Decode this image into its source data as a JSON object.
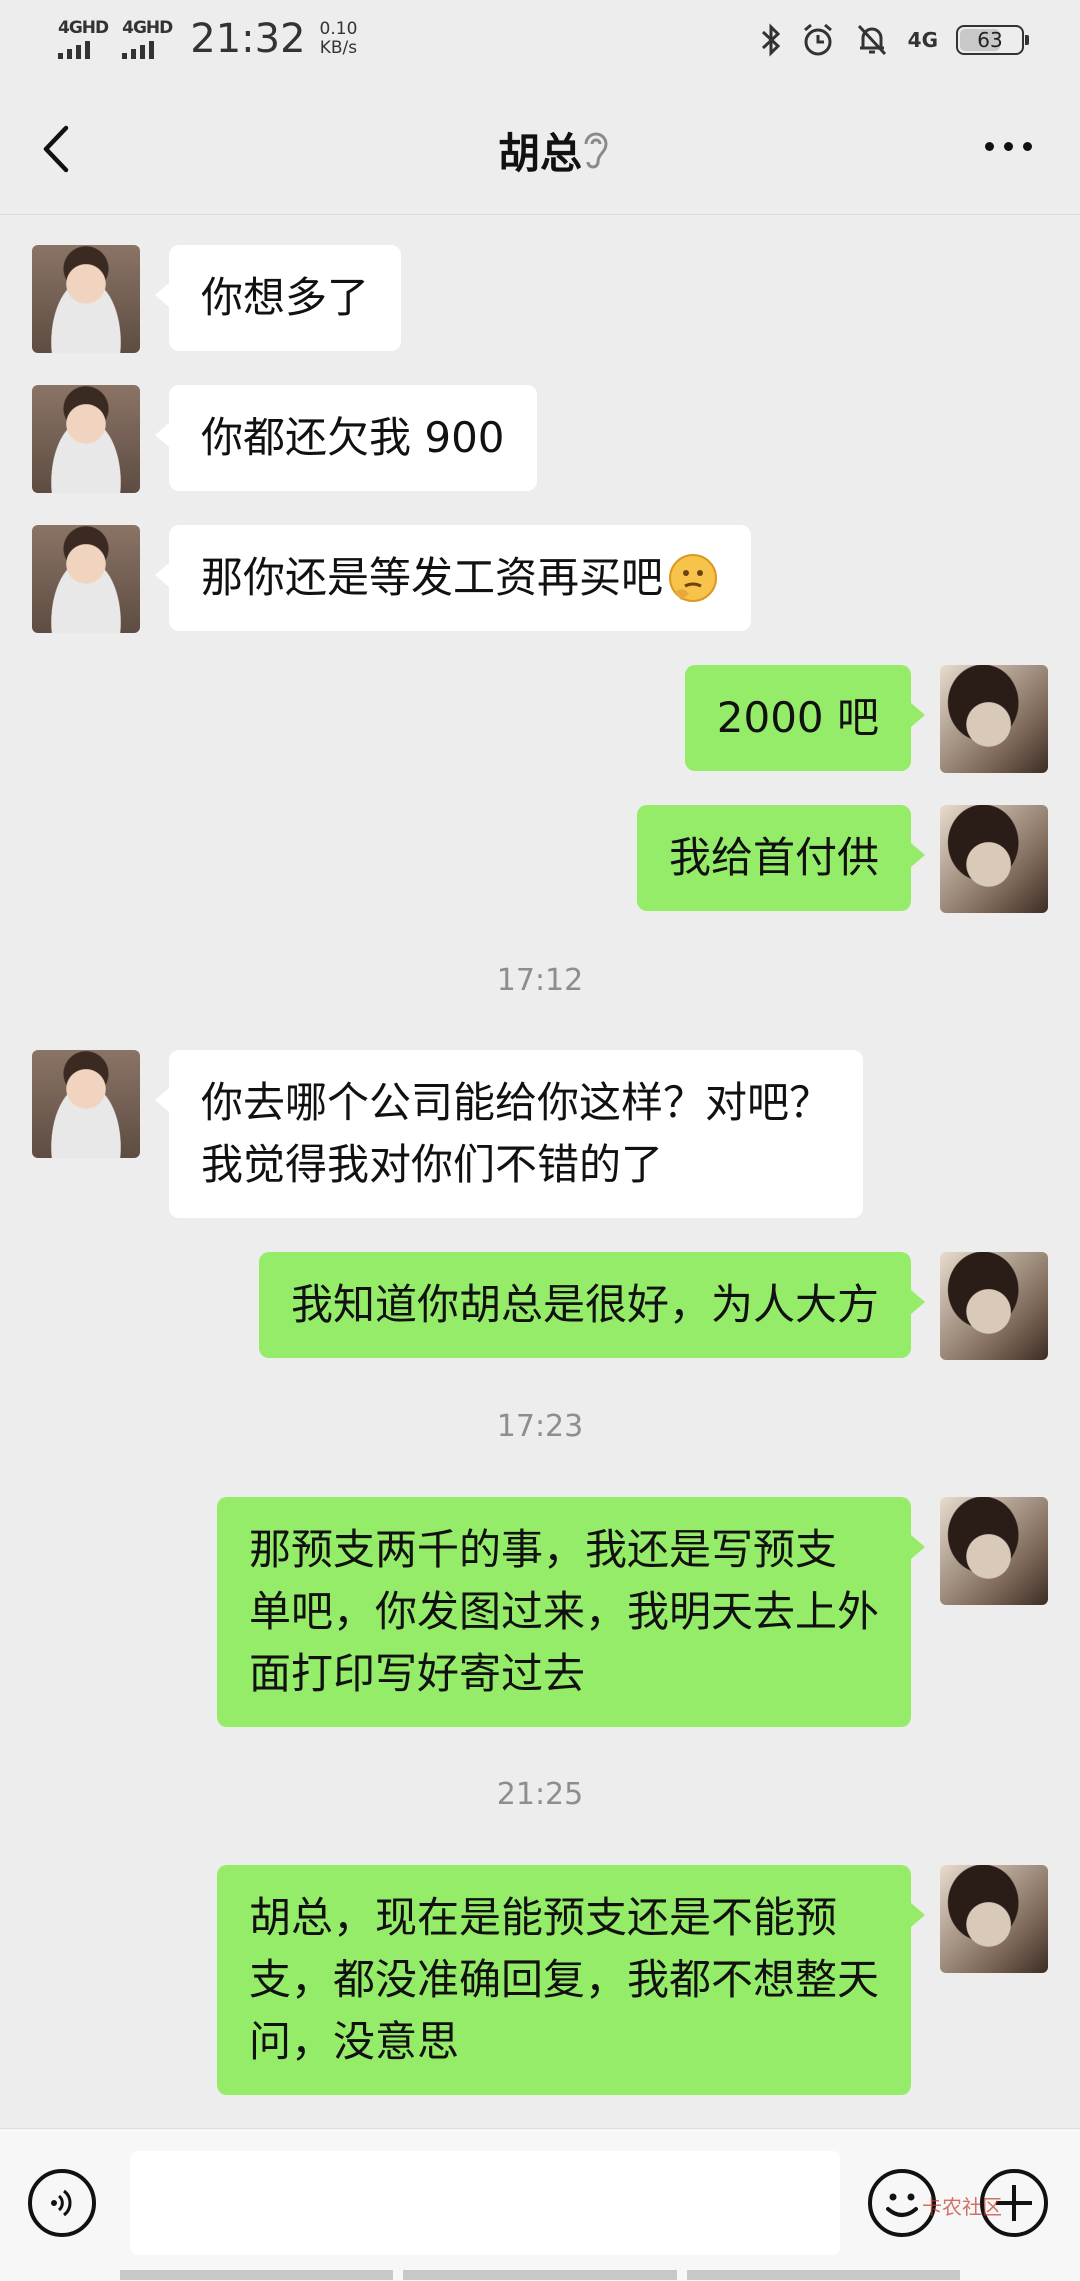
{
  "status_bar": {
    "signal_1": "4GHD",
    "signal_2": "4GHD",
    "time": "21:32",
    "speed_value": "0.10",
    "speed_unit": "KB/s",
    "network": "4G",
    "battery": "63",
    "icons": [
      "bluetooth-icon",
      "alarm-icon",
      "mute-icon"
    ]
  },
  "header": {
    "title": "胡总",
    "icons": [
      "back-icon",
      "earpiece-icon",
      "more-icon"
    ]
  },
  "messages": [
    {
      "side": "in",
      "text": "你想多了"
    },
    {
      "side": "in",
      "text": "你都还欠我 900"
    },
    {
      "side": "in",
      "text": "那你还是等发工资再买吧",
      "emoji": "thinking-face"
    },
    {
      "side": "out",
      "text": "2000 吧"
    },
    {
      "side": "out",
      "text": "我给首付供"
    },
    {
      "time": "17:12"
    },
    {
      "side": "in",
      "text": "你去哪个公司能给你这样？对吧？\n我觉得我对你们不错的了"
    },
    {
      "side": "out",
      "text": "我知道你胡总是很好，为人大方"
    },
    {
      "time": "17:23"
    },
    {
      "side": "out",
      "text": "那预支两千的事，我还是写预支\n单吧，你发图过来，我明天去上外\n面打印写好寄过去"
    },
    {
      "time": "21:25"
    },
    {
      "side": "out",
      "text": "胡总，现在是能预支还是不能预\n支，都没准确回复，我都不想整天\n问，没意思"
    }
  ],
  "input_bar": {
    "icons": [
      "voice-icon",
      "emoji-icon",
      "plus-icon"
    ],
    "watermark": "卡农社区"
  },
  "colors": {
    "background": "#ededed",
    "outgoing_bubble": "#95ec69",
    "incoming_bubble": "#ffffff",
    "timestamp": "#8e8e8e"
  }
}
